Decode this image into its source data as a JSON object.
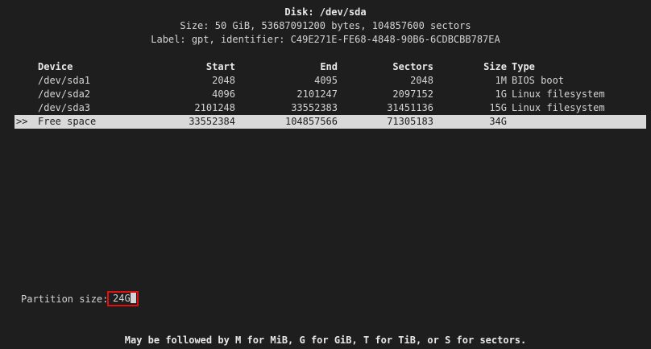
{
  "header": {
    "title": "Disk: /dev/sda",
    "size_line": "Size: 50 GiB, 53687091200 bytes, 104857600 sectors",
    "label_line": "Label: gpt, identifier: C49E271E-FE68-4848-90B6-6CDBCBB787EA"
  },
  "table": {
    "columns": [
      "Device",
      "Start",
      "End",
      "Sectors",
      "Size",
      "Type"
    ],
    "rows": [
      {
        "pointer": "",
        "device": "/dev/sda1",
        "start": "2048",
        "end": "4095",
        "sectors": "2048",
        "size": "1M",
        "type": "BIOS boot"
      },
      {
        "pointer": "",
        "device": "/dev/sda2",
        "start": "4096",
        "end": "2101247",
        "sectors": "2097152",
        "size": "1G",
        "type": "Linux filesystem"
      },
      {
        "pointer": "",
        "device": "/dev/sda3",
        "start": "2101248",
        "end": "33552383",
        "sectors": "31451136",
        "size": "15G",
        "type": "Linux filesystem"
      },
      {
        "pointer": ">>",
        "device": "Free space",
        "start": "33552384",
        "end": "104857566",
        "sectors": "71305183",
        "size": "34G",
        "type": ""
      }
    ]
  },
  "prompt": {
    "label": "Partition size:",
    "value": "24G"
  },
  "hint": "May be followed by M for MiB, G for GiB, T for TiB, or S for sectors."
}
